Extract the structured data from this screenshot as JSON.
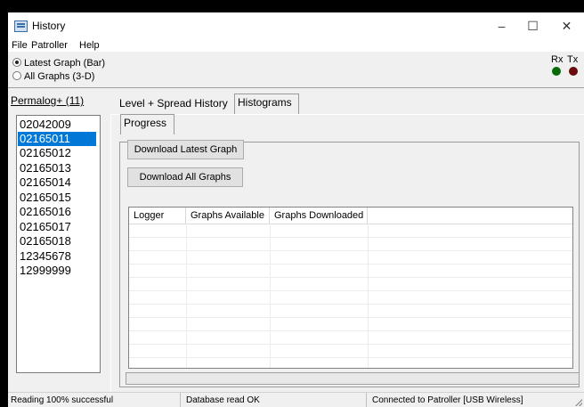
{
  "window": {
    "title": "History"
  },
  "controls": {
    "minimize": "–",
    "maximize": "☐",
    "close": "✕"
  },
  "menu": {
    "items": [
      "File",
      "Patroller",
      "Help"
    ]
  },
  "mode": {
    "options": [
      {
        "label": "Latest Graph (Bar)",
        "selected": true
      },
      {
        "label": "All Graphs (3-D)",
        "selected": false
      }
    ]
  },
  "indicators": {
    "rx": {
      "label": "Rx",
      "color": "#0a6b0a"
    },
    "tx": {
      "label": "Tx",
      "color": "#6b0a0a"
    }
  },
  "sidebar": {
    "header": "Permalog+ (11)",
    "items": [
      "02042009",
      "02165011",
      "02165012",
      "02165013",
      "02165014",
      "02165015",
      "02165016",
      "02165017",
      "02165018",
      "12345678",
      "12999999"
    ],
    "selected_index": 1
  },
  "tabs": {
    "main": [
      "Level + Spread History",
      "Histograms"
    ],
    "sub": [
      "Progress"
    ]
  },
  "buttons": {
    "download_latest": "Download Latest Graph",
    "download_all": "Download All Graphs"
  },
  "grid": {
    "columns": [
      "Logger",
      "Graphs Available",
      "Graphs Downloaded"
    ],
    "rows": []
  },
  "status": {
    "reading": "Reading 100% successful",
    "database": "Database read OK",
    "connection": "Connected to Patroller [USB Wireless]"
  }
}
